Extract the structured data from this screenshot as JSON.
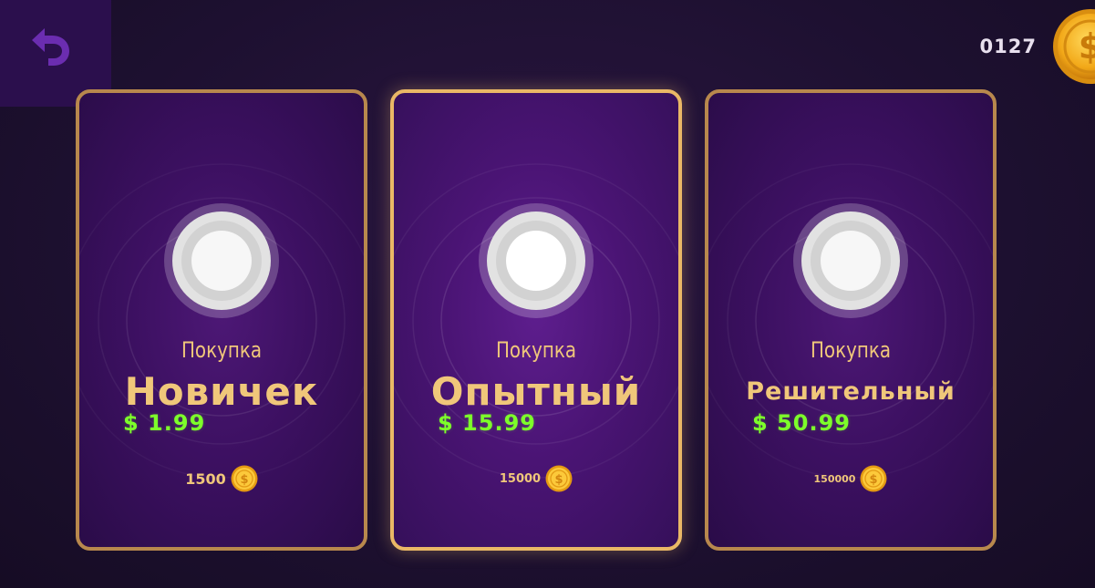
{
  "balance": {
    "count": "0127",
    "coin_icon": "gold-dollar-coin-icon"
  },
  "navigation": {
    "back_icon": "undo-arrow-icon"
  },
  "colors": {
    "card_border": "#b8884d",
    "card_border_featured": "#eab866",
    "label_gold": "#f0c77a",
    "price_green": "#7dff2a",
    "card_purple": "#4d1876"
  },
  "packs": [
    {
      "kicker": "Покупка",
      "name": "Новичек",
      "price": "$ 1.99",
      "coins": "1500",
      "featured": false
    },
    {
      "kicker": "Покупка",
      "name": "Опытный",
      "price": "$ 15.99",
      "coins": "15000",
      "featured": true
    },
    {
      "kicker": "Покупка",
      "name": "Решительный",
      "price": "$ 50.99",
      "coins": "150000",
      "featured": false
    }
  ]
}
